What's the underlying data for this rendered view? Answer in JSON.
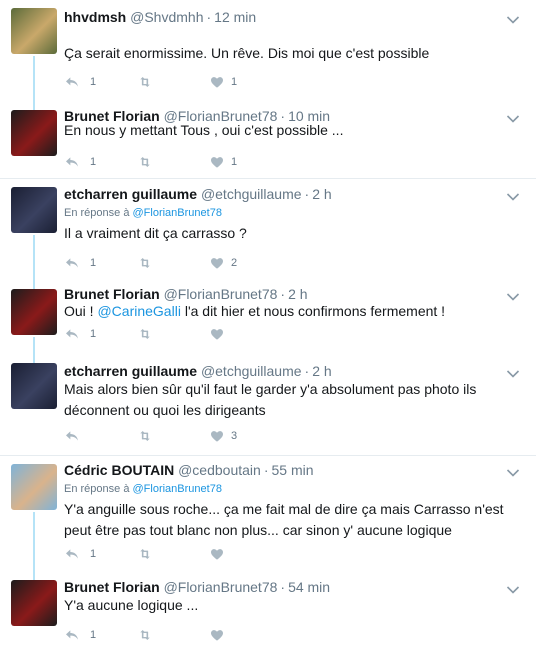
{
  "tweets": [
    {
      "name": "hhvdmsh",
      "handle": "@Shvdmhh",
      "time": "12 min",
      "in_reply_label": "",
      "in_reply_to": "",
      "text_before": "Ça serait enormissime. Un rêve. Dis moi que c'est possible",
      "mention": "",
      "text_after": "",
      "reply_count": "1",
      "retweet_count": "",
      "like_count": "1",
      "avatar_colors": [
        "#5b6b3a",
        "#c9a86a"
      ]
    },
    {
      "name": "Brunet Florian",
      "handle": "@FlorianBrunet78",
      "time": "10 min",
      "in_reply_label": "",
      "in_reply_to": "",
      "text_before": "En nous y mettant Tous , oui c'est possible ...",
      "mention": "",
      "text_after": "",
      "reply_count": "1",
      "retweet_count": "",
      "like_count": "1",
      "avatar_colors": [
        "#1c1c1c",
        "#8a1a1a"
      ]
    },
    {
      "name": "etcharren guillaume",
      "handle": "@etchguillaume",
      "time": "2 h",
      "in_reply_label": "En réponse à",
      "in_reply_to": "@FlorianBrunet78",
      "text_before": "Il a vraiment dit ça carrasso ?",
      "mention": "",
      "text_after": "",
      "reply_count": "1",
      "retweet_count": "",
      "like_count": "2",
      "avatar_colors": [
        "#1a1f33",
        "#3a4160"
      ]
    },
    {
      "name": "Brunet Florian",
      "handle": "@FlorianBrunet78",
      "time": "2 h",
      "in_reply_label": "",
      "in_reply_to": "",
      "text_before": "Oui ! ",
      "mention": "@CarineGalli",
      "text_after": " l'a dit hier et nous confirmons fermement !",
      "reply_count": "1",
      "retweet_count": "",
      "like_count": "",
      "avatar_colors": [
        "#1c1c1c",
        "#8a1a1a"
      ]
    },
    {
      "name": "etcharren guillaume",
      "handle": "@etchguillaume",
      "time": "2 h",
      "in_reply_label": "",
      "in_reply_to": "",
      "text_before": "Mais alors bien sûr qu'il faut le garder y'a absolument pas photo ils déconnent ou quoi les dirigeants",
      "mention": "",
      "text_after": "",
      "reply_count": "",
      "retweet_count": "",
      "like_count": "3",
      "avatar_colors": [
        "#1a1f33",
        "#3a4160"
      ]
    },
    {
      "name": "Cédric BOUTAIN",
      "handle": "@cedboutain",
      "time": "55 min",
      "in_reply_label": "En réponse à",
      "in_reply_to": "@FlorianBrunet78",
      "text_before": "Y'a anguille sous roche... ça me fait mal de dire ça mais Carrasso n'est peut être pas tout blanc non plus... car sinon y' aucune logique",
      "mention": "",
      "text_after": "",
      "reply_count": "1",
      "retweet_count": "",
      "like_count": "",
      "avatar_colors": [
        "#7fb3d8",
        "#d9b38c"
      ]
    },
    {
      "name": "Brunet Florian",
      "handle": "@FlorianBrunet78",
      "time": "54 min",
      "in_reply_label": "",
      "in_reply_to": "",
      "text_before": "Y'a aucune logique ...",
      "mention": "",
      "text_after": "",
      "reply_count": "1",
      "retweet_count": "",
      "like_count": "",
      "avatar_colors": [
        "#1c1c1c",
        "#8a1a1a"
      ]
    }
  ],
  "colors": {
    "name": "#14171a",
    "secondary": "#657786",
    "link": "#1b95e0",
    "thread_line": "#b5e3f7",
    "separator": "#e6ecf0",
    "icon": "#aab8c2"
  },
  "icons": {
    "reply": "reply-icon",
    "retweet": "retweet-icon",
    "like": "heart-icon",
    "menu": "chevron-down-icon"
  }
}
